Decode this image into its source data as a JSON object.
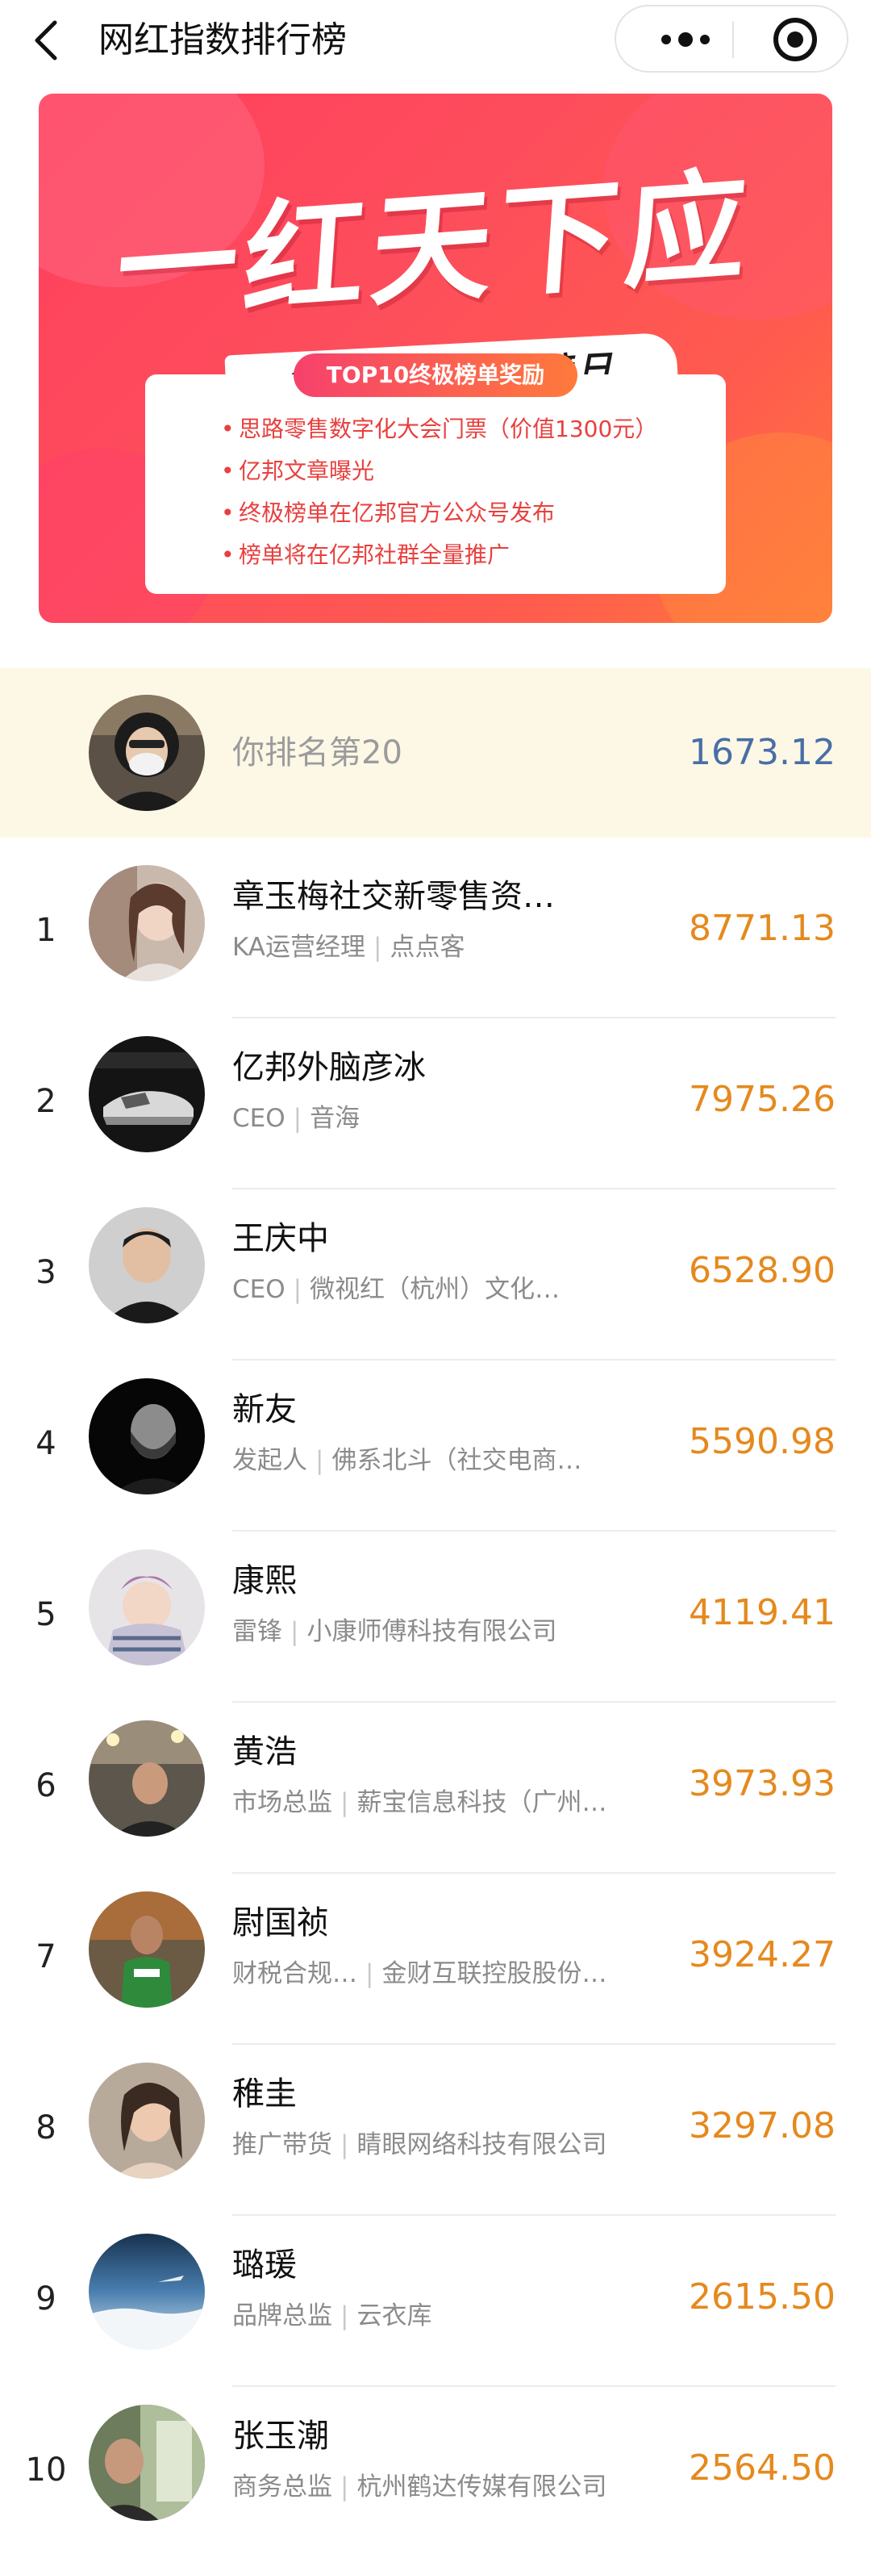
{
  "nav": {
    "title": "网红指数排行榜",
    "icons": [
      "back-arrow-icon",
      "more-dots-icon",
      "target-circle-icon"
    ]
  },
  "banner": {
    "headline": "一红天下应",
    "subline": "828电商人冲榜日",
    "tag": "TOP10终极榜单奖励",
    "bullets": [
      "思路零售数字化大会门票（价值1300元）",
      "亿邦文章曝光",
      "终极榜单在亿邦官方公众号发布",
      "榜单将在亿邦社群全量推广"
    ],
    "colors": {
      "bg": "#fd4d5c",
      "bullet": "#e8403e"
    }
  },
  "my_rank": {
    "text": "你排名第20",
    "score": "1673.12"
  },
  "ranking": [
    {
      "rank": "1",
      "name": "章玉梅社交新零售资…",
      "title": "KA运营经理",
      "company": "点点客",
      "score": "8771.13"
    },
    {
      "rank": "2",
      "name": "亿邦外脑彦冰",
      "title": "CEO",
      "company": "音海",
      "score": "7975.26"
    },
    {
      "rank": "3",
      "name": "王庆中",
      "title": "CEO",
      "company": "微视红（杭州）文化…",
      "score": "6528.90"
    },
    {
      "rank": "4",
      "name": "新友",
      "title": "发起人",
      "company": "佛系北斗（社交电商…",
      "score": "5590.98"
    },
    {
      "rank": "5",
      "name": "康熙",
      "title": "雷锋",
      "company": "小康师傅科技有限公司",
      "score": "4119.41"
    },
    {
      "rank": "6",
      "name": "黄浩",
      "title": "市场总监",
      "company": "薪宝信息科技（广州…",
      "score": "3973.93"
    },
    {
      "rank": "7",
      "name": "尉国祯",
      "title": "财税合规…",
      "company": "金财互联控股股份…",
      "score": "3924.27"
    },
    {
      "rank": "8",
      "name": "稚圭",
      "title": "推广带货",
      "company": "睛眼网络科技有限公司",
      "score": "3297.08"
    },
    {
      "rank": "9",
      "name": "璐瑗",
      "title": "品牌总监",
      "company": "云衣库",
      "score": "2615.50"
    },
    {
      "rank": "10",
      "name": "张玉潮",
      "title": "商务总监",
      "company": "杭州鹤达传媒有限公司",
      "score": "2564.50"
    }
  ],
  "separator": "|",
  "colors": {
    "score": "#e5891e",
    "my_score": "#4a6ea5",
    "my_row_bg": "#fdf8e6"
  }
}
